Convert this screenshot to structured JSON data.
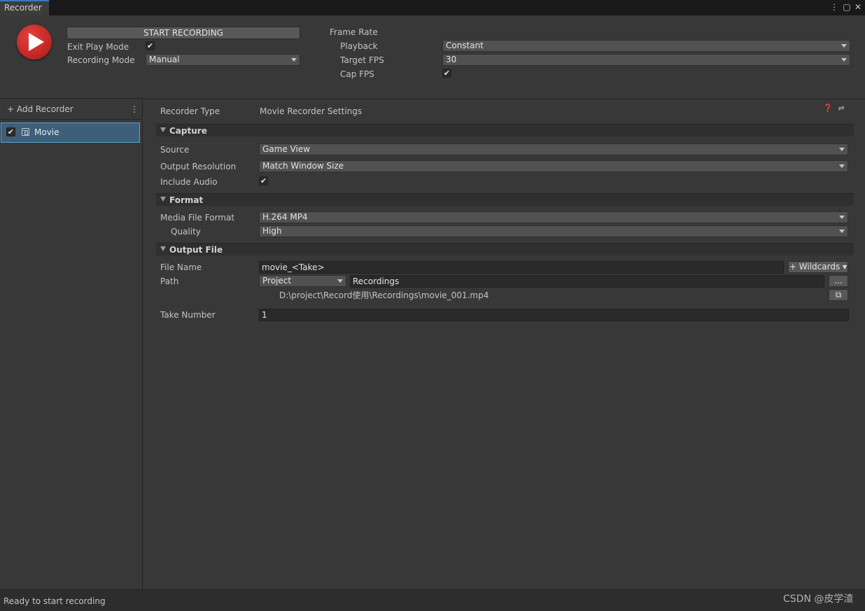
{
  "window": {
    "tab_title": "Recorder",
    "menu_glyph": "⋮",
    "maximize_glyph": "▢",
    "close_glyph": "✕"
  },
  "header": {
    "start_label": "START RECORDING",
    "exit_play_mode_label": "Exit Play Mode",
    "exit_play_mode_checked": "✔",
    "recording_mode_label": "Recording Mode",
    "recording_mode_value": "Manual",
    "frame_rate_label": "Frame Rate",
    "playback_label": "Playback",
    "playback_value": "Constant",
    "target_fps_label": "Target FPS",
    "target_fps_value": "30",
    "cap_fps_label": "Cap FPS",
    "cap_fps_checked": "✔"
  },
  "sidebar": {
    "add_recorder_label": "+ Add Recorder",
    "menu_glyph": "⋮",
    "items": [
      {
        "label": "Movie",
        "checked": "✔"
      }
    ]
  },
  "main": {
    "recorder_type_label": "Recorder Type",
    "recorder_type_value": "Movie Recorder Settings",
    "help_glyph": "❓",
    "presets_glyph": "⇌",
    "sections": {
      "capture": {
        "title": "Capture",
        "source_label": "Source",
        "source_value": "Game View",
        "output_resolution_label": "Output Resolution",
        "output_resolution_value": "Match Window Size",
        "include_audio_label": "Include Audio",
        "include_audio_checked": "✔"
      },
      "format": {
        "title": "Format",
        "media_file_format_label": "Media File Format",
        "media_file_format_value": "H.264 MP4",
        "quality_label": "Quality",
        "quality_value": "High"
      },
      "output_file": {
        "title": "Output File",
        "file_name_label": "File Name",
        "file_name_value": "movie_<Take>",
        "wildcards_label": "+ Wildcards ▾",
        "path_label": "Path",
        "path_root_value": "Project",
        "path_folder_value": "Recordings",
        "browse_label": "...",
        "resolved_path": "D:\\project\\Record使用\\Recordings\\movie_001.mp4",
        "open_folder_glyph": "⧉"
      },
      "take": {
        "take_number_label": "Take Number",
        "take_number_value": "1"
      }
    }
  },
  "status": {
    "message": "Ready to start recording",
    "watermark": "CSDN @皮学渣"
  }
}
